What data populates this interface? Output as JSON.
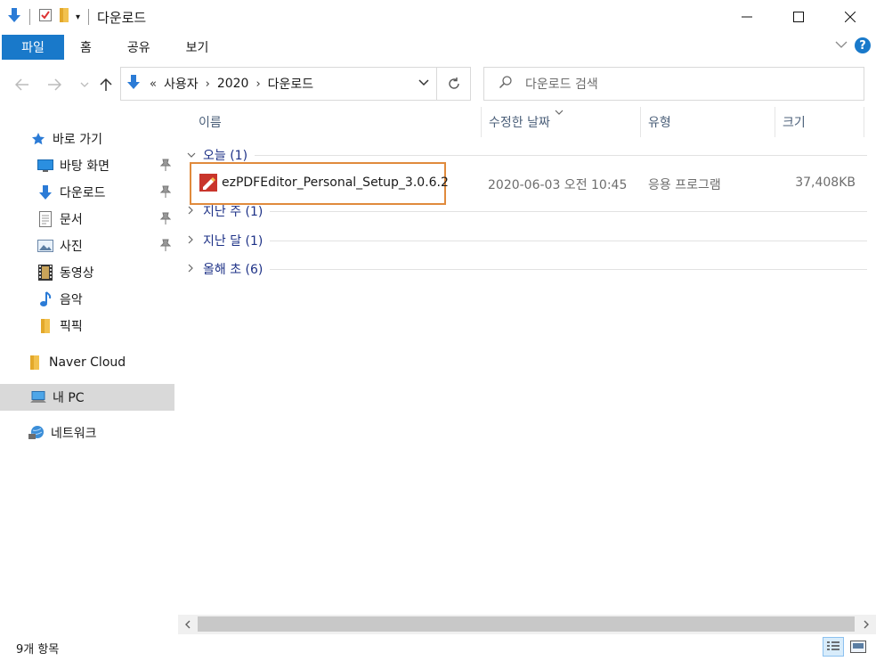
{
  "window": {
    "title": "다운로드",
    "controls": {
      "minimize": "─",
      "maximize": "☐",
      "close": "✕"
    }
  },
  "ribbon": {
    "tabs": [
      {
        "label": "파일",
        "active": true
      },
      {
        "label": "홈"
      },
      {
        "label": "공유"
      },
      {
        "label": "보기"
      }
    ],
    "help_label": "?"
  },
  "address": {
    "overflow": "«",
    "crumbs": [
      "사용자",
      "2020",
      "다운로드"
    ],
    "search_placeholder": "다운로드 검색"
  },
  "nav": {
    "quick_access": "바로 가기",
    "pinned": [
      {
        "label": "바탕 화면",
        "icon": "desktop-icon"
      },
      {
        "label": "다운로드",
        "icon": "download-icon"
      },
      {
        "label": "문서",
        "icon": "document-icon"
      },
      {
        "label": "사진",
        "icon": "picture-icon"
      }
    ],
    "others": [
      {
        "label": "동영상",
        "icon": "video-icon"
      },
      {
        "label": "음악",
        "icon": "music-icon"
      },
      {
        "label": "픽픽",
        "icon": "folder-icon"
      }
    ],
    "naver": "Naver Cloud",
    "this_pc": "내 PC",
    "network": "네트워크"
  },
  "columns": {
    "name": "이름",
    "date": "수정한 날짜",
    "type": "유형",
    "size": "크기"
  },
  "groups": {
    "today": "오늘 (1)",
    "last_week": "지난 주 (1)",
    "last_month": "지난 달 (1)",
    "earlier_year": "올해 초 (6)"
  },
  "files": [
    {
      "name": "ezPDFEditor_Personal_Setup_3.0.6.2",
      "date": "2020-06-03 오전 10:45",
      "type": "응용 프로그램",
      "size": "37,408KB"
    }
  ],
  "status": {
    "count": "9개 항목"
  },
  "colors": {
    "accent": "#1979ca",
    "highlight_border": "#e08a3c",
    "group_text": "#1e3287"
  }
}
